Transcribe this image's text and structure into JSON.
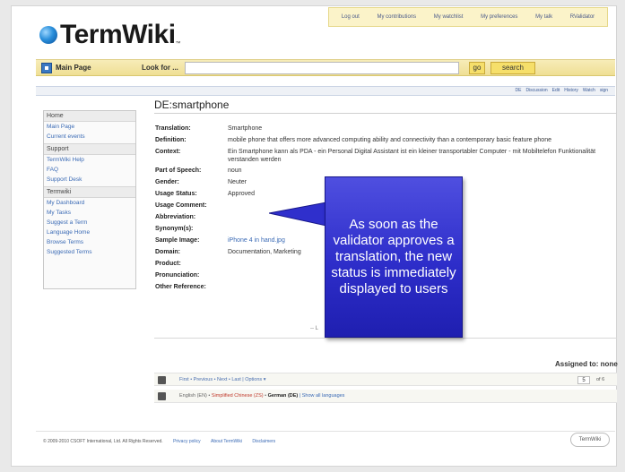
{
  "topbar": {
    "links": [
      "Log out",
      "My contributions",
      "My watchlist",
      "My preferences",
      "My talk",
      "RValidator"
    ]
  },
  "logo": {
    "text": "TermWiki",
    "tm": "™"
  },
  "searchbar": {
    "main_page": "Main Page",
    "look_for": "Look for ...",
    "search_value": "",
    "go_label": "go",
    "search_label": "search"
  },
  "page_tabs": [
    "DE",
    "Discussion",
    "Edit",
    "History",
    "Watch",
    "sign"
  ],
  "sidebar": {
    "sections": [
      {
        "heading": "Home",
        "items": [
          "Main Page",
          "Current events"
        ]
      },
      {
        "heading": "Support",
        "items": [
          "TermWiki Help",
          "FAQ",
          "Support Desk"
        ]
      },
      {
        "heading": "Termwiki",
        "items": [
          "My Dashboard",
          "My Tasks",
          "Suggest a Term",
          "Language Home",
          "Browse Terms",
          "Suggested Terms"
        ]
      }
    ]
  },
  "main": {
    "title": "DE:smartphone",
    "fields": [
      {
        "label": "Translation:",
        "value": "Smartphone"
      },
      {
        "label": "Definition:",
        "value": "mobile phone that offers more advanced computing ability and connectivity than a contemporary basic feature phone"
      },
      {
        "label": "Context:",
        "value": "Ein Smartphone kann als PDA - ein Personal Digital Assistant ist ein kleiner transportabler Computer - mit Mobiltelefon Funktionalität verstanden werden"
      },
      {
        "label": "Part of Speech:",
        "value": "noun"
      },
      {
        "label": "Gender:",
        "value": "Neuter"
      },
      {
        "label": "Usage Status:",
        "value": "Approved"
      },
      {
        "label": "Usage Comment:",
        "value": ""
      },
      {
        "label": "Abbreviation:",
        "value": ""
      },
      {
        "label": "Synonym(s):",
        "value": ""
      },
      {
        "label": "Sample Image:",
        "value": "iPhone 4 in hand.jpg"
      },
      {
        "label": "Domain:",
        "value": "Documentation, Marketing"
      },
      {
        "label": "Product:",
        "value": ""
      },
      {
        "label": "Pronunciation:",
        "value": ""
      },
      {
        "label": "Other Reference:",
        "value": ""
      }
    ],
    "separator_text": "-- L",
    "assigned_to": "Assigned to: none",
    "pager": {
      "text": "First • Previous • Next • Last | Options ▾",
      "page_value": "5",
      "of_text": "of 6"
    },
    "languages": {
      "en": "English (EN) •",
      "zh": "Simplified Chinese (ZS)",
      "sep": " • ",
      "de": "German (DE)",
      "all": " | Show all languages"
    }
  },
  "footer": {
    "copyright": "© 2009-2010 CSOFT International, Ltd. All Rights Reserved.",
    "links": [
      "Privacy policy",
      "About TermWiki",
      "Disclaimers"
    ],
    "badge": "TermWiki"
  },
  "callout": {
    "text": "As soon as the validator approves a translation, the new status is immediately displayed to users"
  },
  "colors": {
    "accent": "#3a6ab5",
    "callout": "#2d2dc9",
    "topbar": "#fbf3c9"
  }
}
